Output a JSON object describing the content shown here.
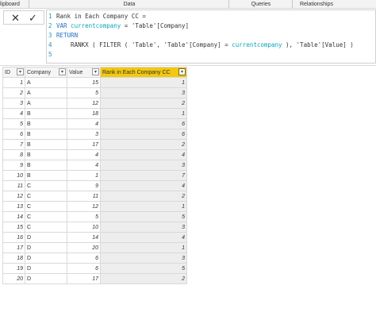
{
  "ribbon": {
    "groups": [
      "lipboard",
      "Data",
      "Queries",
      "Relationships"
    ]
  },
  "formula": {
    "cancel_icon": "close-icon",
    "commit_icon": "checkmark-icon",
    "lines": [
      {
        "num": "1",
        "parts": [
          {
            "t": "Rank in Each Company CC =",
            "c": "tx"
          }
        ]
      },
      {
        "num": "2",
        "parts": [
          {
            "t": "VAR ",
            "c": "kw"
          },
          {
            "t": "currentcompany",
            "c": "vr"
          },
          {
            "t": " = 'Table'[Company]",
            "c": "tx"
          }
        ]
      },
      {
        "num": "3",
        "parts": [
          {
            "t": "RETURN",
            "c": "kw"
          }
        ]
      },
      {
        "num": "4",
        "parts": [
          {
            "t": "    RANKX ( FILTER ( 'Table', 'Table'[Company] = ",
            "c": "tx"
          },
          {
            "t": "currentcompany",
            "c": "vr"
          },
          {
            "t": " ), 'Table'[Value] )",
            "c": "tx"
          }
        ]
      },
      {
        "num": "5",
        "parts": []
      }
    ]
  },
  "table": {
    "columns": [
      "ID",
      "Company",
      "Value",
      "Rank in Each Company CC"
    ],
    "rows": [
      [
        "1",
        "A",
        "15",
        "1"
      ],
      [
        "2",
        "A",
        "5",
        "3"
      ],
      [
        "3",
        "A",
        "12",
        "2"
      ],
      [
        "4",
        "B",
        "18",
        "1"
      ],
      [
        "5",
        "B",
        "4",
        "6"
      ],
      [
        "6",
        "B",
        "3",
        "6"
      ],
      [
        "7",
        "B",
        "17",
        "2"
      ],
      [
        "8",
        "B",
        "4",
        "4"
      ],
      [
        "9",
        "B",
        "4",
        "3"
      ],
      [
        "10",
        "B",
        "1",
        "7"
      ],
      [
        "11",
        "C",
        "9",
        "4"
      ],
      [
        "12",
        "C",
        "11",
        "2"
      ],
      [
        "13",
        "C",
        "12",
        "1"
      ],
      [
        "14",
        "C",
        "5",
        "5"
      ],
      [
        "15",
        "C",
        "10",
        "3"
      ],
      [
        "16",
        "D",
        "14",
        "4"
      ],
      [
        "17",
        "D",
        "20",
        "1"
      ],
      [
        "18",
        "D",
        "6",
        "3"
      ],
      [
        "19",
        "D",
        "6",
        "5"
      ],
      [
        "20",
        "D",
        "17",
        "2"
      ]
    ]
  },
  "colors": {
    "selected_header": "#f2c811",
    "keyword": "#1f6fc4",
    "variable": "#0aa4b8"
  }
}
